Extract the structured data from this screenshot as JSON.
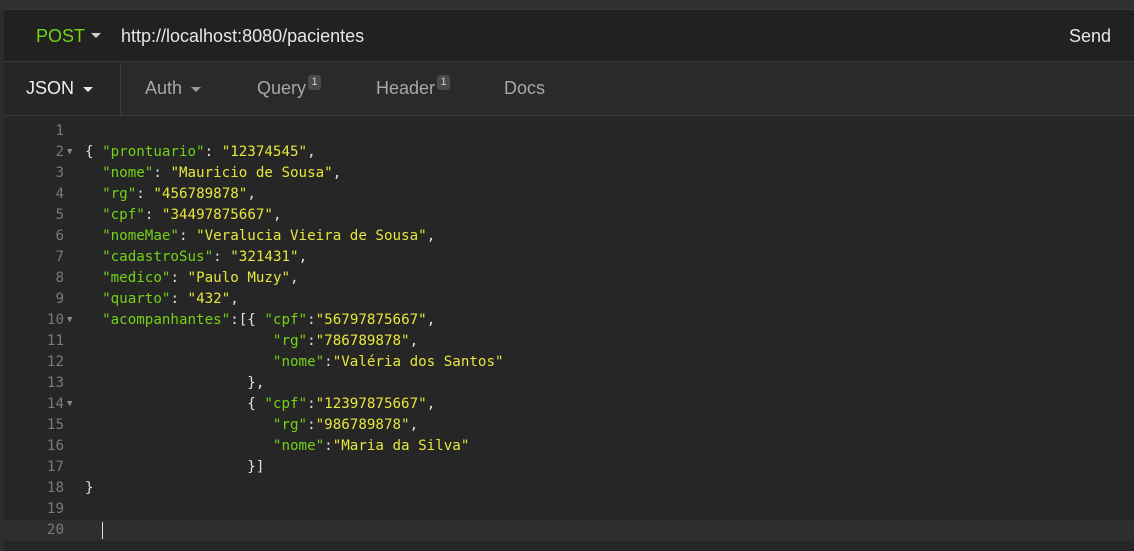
{
  "request": {
    "method": "POST",
    "url": "http://localhost:8080/pacientes",
    "send_label": "Send"
  },
  "tabs": [
    {
      "label": "JSON",
      "active": true,
      "has_dropdown": true
    },
    {
      "label": "Auth",
      "has_dropdown": true
    },
    {
      "label": "Query",
      "badge": "1"
    },
    {
      "label": "Header",
      "badge": "1"
    },
    {
      "label": "Docs"
    }
  ],
  "editor": {
    "line_numbers": [
      "1",
      "2",
      "3",
      "4",
      "5",
      "6",
      "7",
      "8",
      "9",
      "10",
      "11",
      "12",
      "13",
      "14",
      "15",
      "16",
      "17",
      "18",
      "19",
      "20"
    ],
    "lines": [
      [],
      [
        [
          "p",
          "{ "
        ],
        [
          "k",
          "\"prontuario\""
        ],
        [
          "p",
          ": "
        ],
        [
          "s",
          "\"12374545\""
        ],
        [
          "p",
          ","
        ]
      ],
      [
        [
          "p",
          "  "
        ],
        [
          "k",
          "\"nome\""
        ],
        [
          "p",
          ": "
        ],
        [
          "s",
          "\"Mauricio de Sousa\""
        ],
        [
          "p",
          ","
        ]
      ],
      [
        [
          "p",
          "  "
        ],
        [
          "k",
          "\"rg\""
        ],
        [
          "p",
          ": "
        ],
        [
          "s",
          "\"456789878\""
        ],
        [
          "p",
          ","
        ]
      ],
      [
        [
          "p",
          "  "
        ],
        [
          "k",
          "\"cpf\""
        ],
        [
          "p",
          ": "
        ],
        [
          "s",
          "\"34497875667\""
        ],
        [
          "p",
          ","
        ]
      ],
      [
        [
          "p",
          "  "
        ],
        [
          "k",
          "\"nomeMae\""
        ],
        [
          "p",
          ": "
        ],
        [
          "s",
          "\"Veralucia Vieira de Sousa\""
        ],
        [
          "p",
          ","
        ]
      ],
      [
        [
          "p",
          "  "
        ],
        [
          "k",
          "\"cadastroSus\""
        ],
        [
          "p",
          ": "
        ],
        [
          "s",
          "\"321431\""
        ],
        [
          "p",
          ","
        ]
      ],
      [
        [
          "p",
          "  "
        ],
        [
          "k",
          "\"medico\""
        ],
        [
          "p",
          ": "
        ],
        [
          "s",
          "\"Paulo Muzy\""
        ],
        [
          "p",
          ","
        ]
      ],
      [
        [
          "p",
          "  "
        ],
        [
          "k",
          "\"quarto\""
        ],
        [
          "p",
          ": "
        ],
        [
          "s",
          "\"432\""
        ],
        [
          "p",
          ","
        ]
      ],
      [
        [
          "p",
          "  "
        ],
        [
          "k",
          "\"acompanhantes\""
        ],
        [
          "p",
          ":[{ "
        ],
        [
          "k",
          "\"cpf\""
        ],
        [
          "p",
          ":"
        ],
        [
          "s",
          "\"56797875667\""
        ],
        [
          "p",
          ","
        ]
      ],
      [
        [
          "p",
          "                      "
        ],
        [
          "k",
          "\"rg\""
        ],
        [
          "p",
          ":"
        ],
        [
          "s",
          "\"786789878\""
        ],
        [
          "p",
          ","
        ]
      ],
      [
        [
          "p",
          "                      "
        ],
        [
          "k",
          "\"nome\""
        ],
        [
          "p",
          ":"
        ],
        [
          "s",
          "\"Valéria dos Santos\""
        ]
      ],
      [
        [
          "p",
          "                   },"
        ]
      ],
      [
        [
          "p",
          "                   { "
        ],
        [
          "k",
          "\"cpf\""
        ],
        [
          "p",
          ":"
        ],
        [
          "s",
          "\"12397875667\""
        ],
        [
          "p",
          ","
        ]
      ],
      [
        [
          "p",
          "                      "
        ],
        [
          "k",
          "\"rg\""
        ],
        [
          "p",
          ":"
        ],
        [
          "s",
          "\"986789878\""
        ],
        [
          "p",
          ","
        ]
      ],
      [
        [
          "p",
          "                      "
        ],
        [
          "k",
          "\"nome\""
        ],
        [
          "p",
          ":"
        ],
        [
          "s",
          "\"Maria da Silva\""
        ]
      ],
      [
        [
          "p",
          "                   }]"
        ]
      ],
      [
        [
          "p",
          "}"
        ]
      ],
      [],
      []
    ],
    "fold_markers": [
      "2",
      "10",
      "14"
    ],
    "current_line": "20"
  }
}
